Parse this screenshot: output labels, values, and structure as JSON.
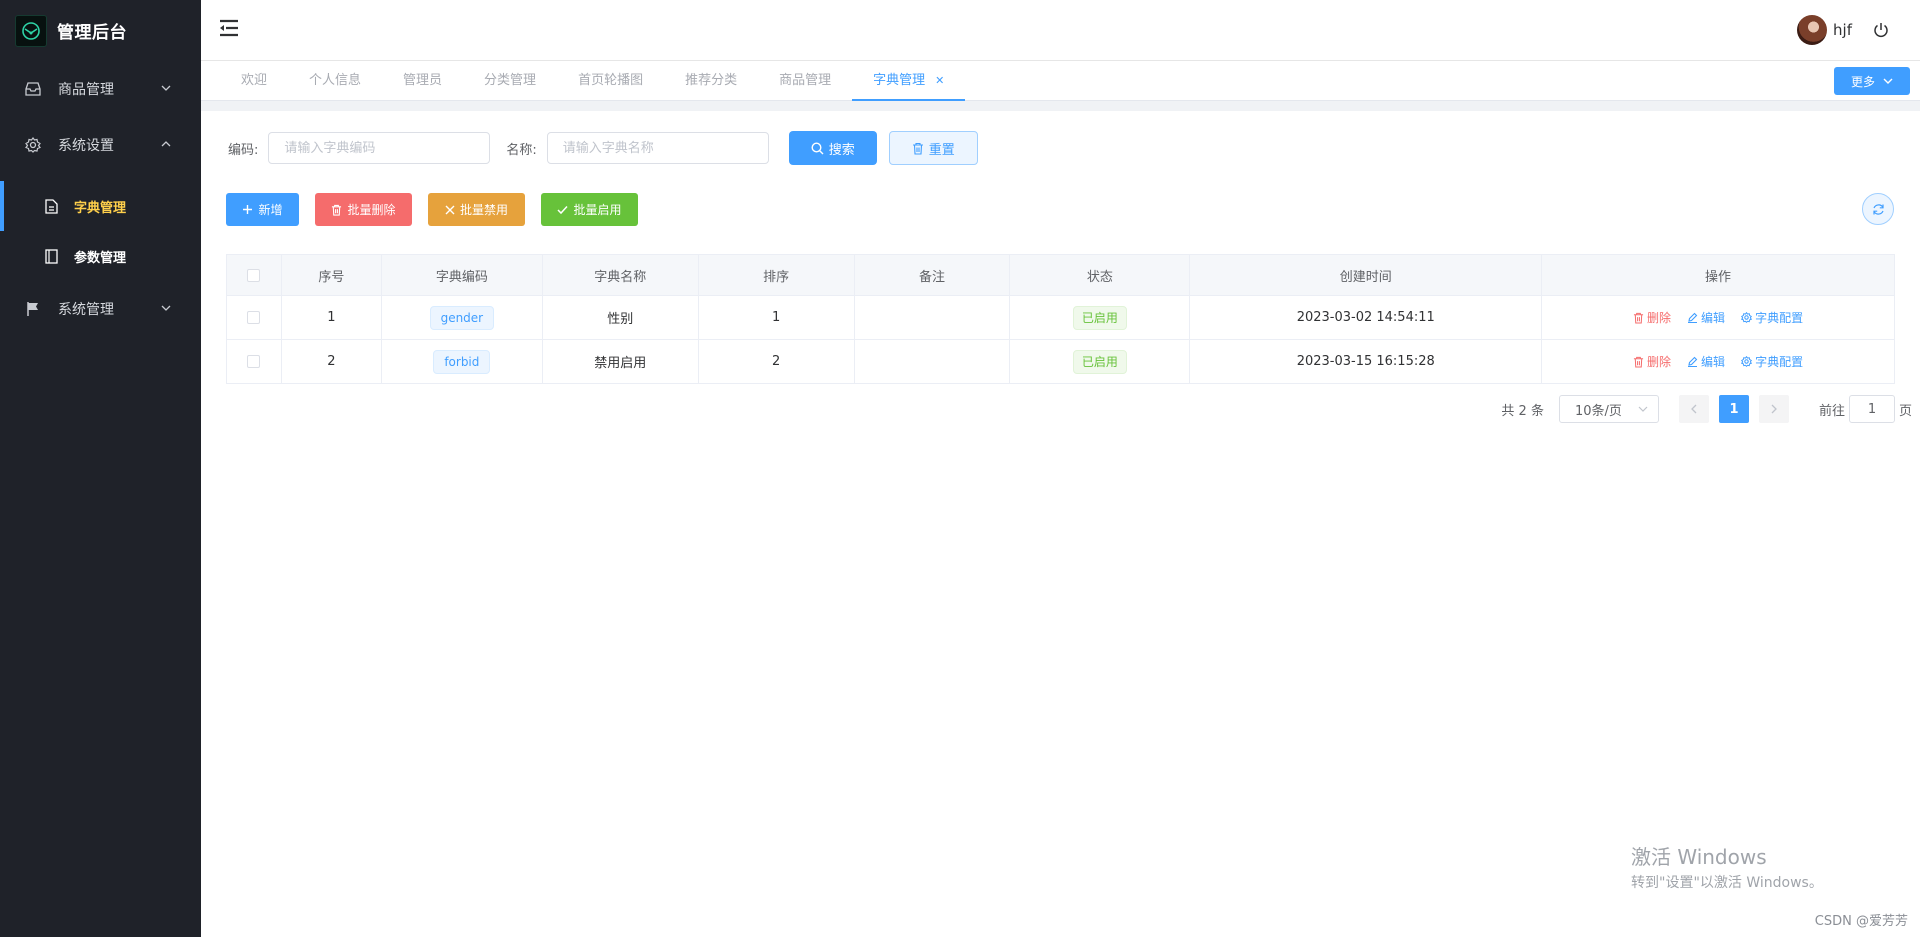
{
  "app": {
    "title": "管理后台"
  },
  "sidebar": {
    "menus": [
      {
        "label": "商品管理",
        "icon": "inbox-icon",
        "expanded": false
      },
      {
        "label": "系统设置",
        "icon": "gear-icon",
        "expanded": true
      },
      {
        "label": "系统管理",
        "icon": "flag-icon",
        "expanded": false
      }
    ],
    "submenus": [
      {
        "label": "字典管理",
        "icon": "document-icon",
        "active": true
      },
      {
        "label": "参数管理",
        "icon": "notebook-icon",
        "active": false
      }
    ]
  },
  "header": {
    "username": "hjf"
  },
  "tabs": {
    "items": [
      "欢迎",
      "个人信息",
      "管理员",
      "分类管理",
      "首页轮播图",
      "推荐分类",
      "商品管理",
      "字典管理"
    ],
    "active_index": 7,
    "more_label": "更多"
  },
  "filter": {
    "code_label": "编码:",
    "code_placeholder": "请输入字典编码",
    "name_label": "名称:",
    "name_placeholder": "请输入字典名称",
    "search_label": "搜索",
    "reset_label": "重置"
  },
  "actions": {
    "add": "新增",
    "batch_delete": "批量删除",
    "batch_disable": "批量禁用",
    "batch_enable": "批量启用"
  },
  "table": {
    "headers": [
      "序号",
      "字典编码",
      "字典名称",
      "排序",
      "备注",
      "状态",
      "创建时间",
      "操作"
    ],
    "rows": [
      {
        "index": "1",
        "code": "gender",
        "name": "性别",
        "sort": "1",
        "remark": "",
        "status": "已启用",
        "created": "2023-03-02 14:54:11"
      },
      {
        "index": "2",
        "code": "forbid",
        "name": "禁用启用",
        "sort": "2",
        "remark": "",
        "status": "已启用",
        "created": "2023-03-15 16:15:28"
      }
    ],
    "op_delete": "删除",
    "op_edit": "编辑",
    "op_config": "字典配置"
  },
  "pagination": {
    "total": "共 2 条",
    "page_size": "10条/页",
    "current": "1",
    "goto_prefix": "前往",
    "goto_value": "1",
    "goto_suffix": "页"
  },
  "watermark": {
    "line1": "激活 Windows",
    "line2": "转到\"设置\"以激活 Windows。",
    "csdn": "CSDN @爱芳芳"
  },
  "colors": {
    "primary": "#409eff",
    "danger": "#f56c6c",
    "warning": "#e6a23c",
    "success": "#67c23a",
    "sidebar_bg": "#1f2229",
    "sidebar_active": "#ffd04b"
  }
}
